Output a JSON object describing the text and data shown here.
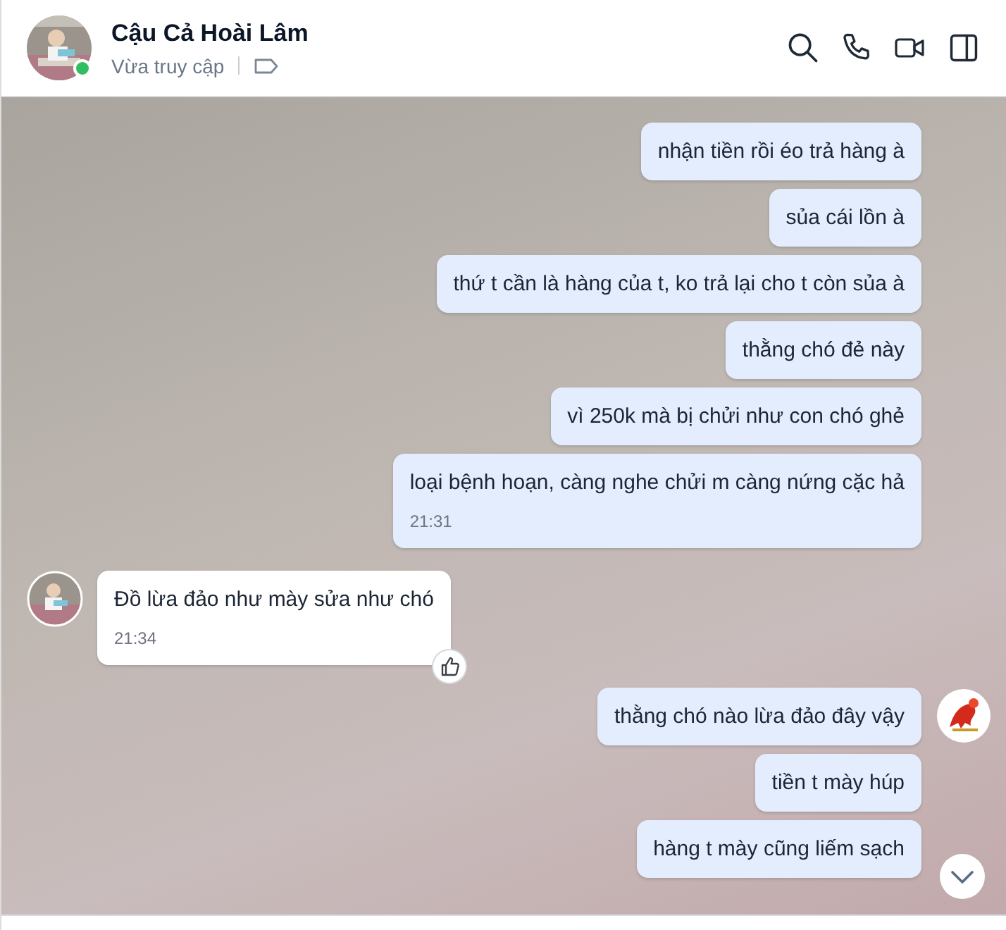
{
  "header": {
    "name": "Cậu Cả Hoài Lâm",
    "status": "Vừa truy cập",
    "online": true
  },
  "messages": [
    {
      "kind": "sent",
      "text": "nhận tiền rồi éo trả hàng à",
      "avatar": false
    },
    {
      "kind": "sent",
      "text": "sủa cái lồn à",
      "avatar": false
    },
    {
      "kind": "sent",
      "text": "thứ t cần là hàng của t, ko trả lại cho t còn sủa à",
      "avatar": false
    },
    {
      "kind": "sent",
      "text": "thằng chó đẻ này",
      "avatar": false
    },
    {
      "kind": "sent",
      "text": "vì 250k mà bị chửi như con chó ghẻ",
      "avatar": false
    },
    {
      "kind": "sent",
      "text": "loại bệnh hoạn, càng nghe chửi m càng nứng cặc hả",
      "time": "21:31",
      "avatar": false
    },
    {
      "kind": "received",
      "text": "Đồ lừa đảo như mày sửa như chó",
      "time": "21:34",
      "avatar": true,
      "like": true
    },
    {
      "kind": "sent",
      "text": "thằng chó nào lừa đảo đây vậy",
      "avatar": true
    },
    {
      "kind": "sent",
      "text": "tiền t mày húp",
      "avatar": false
    },
    {
      "kind": "sent",
      "text": "hàng t mày cũng liếm sạch",
      "avatar": false
    }
  ]
}
